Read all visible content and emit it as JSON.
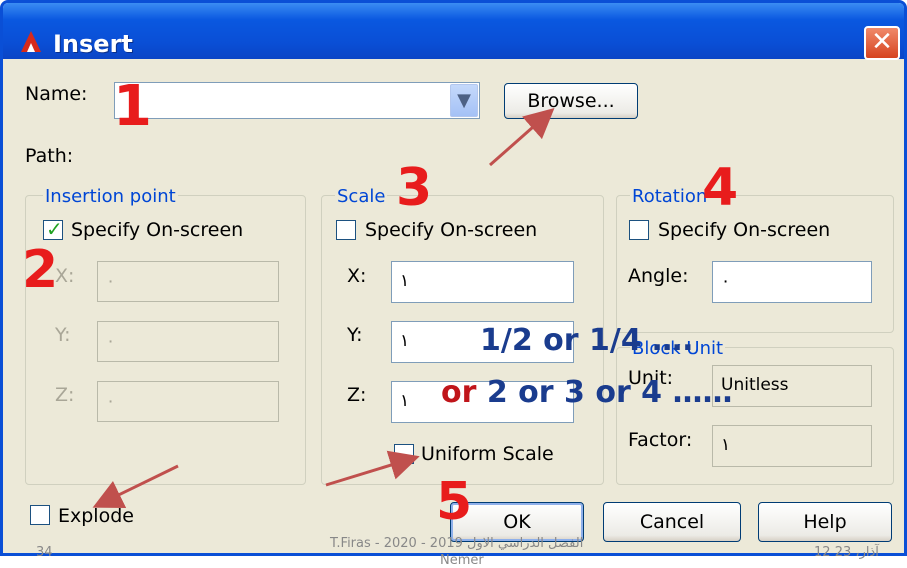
{
  "window": {
    "title": "Insert",
    "close_label": "✕"
  },
  "name_row": {
    "label": "Name:",
    "value": "",
    "browse_label": "Browse..."
  },
  "path": {
    "label": "Path:"
  },
  "insertion_point": {
    "title": "Insertion point",
    "specify_label": "Specify On-screen",
    "specify_checked": true,
    "x_label": "X:",
    "x_value": "٠",
    "y_label": "Y:",
    "y_value": "٠",
    "z_label": "Z:",
    "z_value": "٠"
  },
  "scale": {
    "title": "Scale",
    "specify_label": "Specify On-screen",
    "specify_checked": false,
    "x_label": "X:",
    "x_value": "١",
    "y_label": "Y:",
    "y_value": "١",
    "z_label": "Z:",
    "z_value": "١",
    "uniform_label": "Uniform Scale",
    "uniform_checked": false
  },
  "rotation": {
    "title": "Rotation",
    "specify_label": "Specify On-screen",
    "specify_checked": false,
    "angle_label": "Angle:",
    "angle_value": "٠"
  },
  "block_unit": {
    "title": "Block Unit",
    "unit_label": "Unit:",
    "unit_value": "Unitless",
    "factor_label": "Factor:",
    "factor_value": "١"
  },
  "explode": {
    "label": "Explode",
    "checked": false
  },
  "buttons": {
    "ok": "OK",
    "cancel": "Cancel",
    "help": "Help"
  },
  "annotations": {
    "n1": "1",
    "n2": "2",
    "n3": "3",
    "n4": "4",
    "n5": "5",
    "scale_note_1": "1/2 or 1/4 ….",
    "scale_note_2_red": "or",
    "scale_note_2_blue": " 2 or 3 or 4 ……"
  },
  "footer": {
    "page_number": "34",
    "course": "الفصل الدراسي الاول 2019 - 2020  -  T.Firas",
    "author": "Nemer",
    "date": "12 آذار، 23"
  },
  "colors": {
    "title_bar": "#0a4fd6",
    "dialog_bg": "#ece9d8",
    "group_title": "#0046d5",
    "annotation_red": "#e81c1c",
    "annotation_blue": "#1a3c8e"
  }
}
